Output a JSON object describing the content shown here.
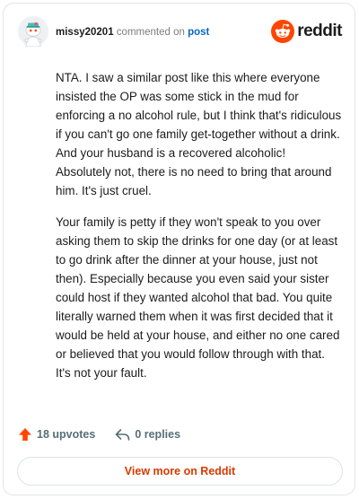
{
  "comment": {
    "author": "missy20201",
    "action_text": "commented on",
    "post_link_label": "post",
    "paragraphs": [
      "NTA. I saw a similar post like this where everyone insisted the OP was some stick in the mud for enforcing a no alcohol rule, but I think that's ridiculous if you can't go one family get-together without a drink. And your husband is a recovered alcoholic! Absolutely not, there is no need to bring that around him. It's just cruel.",
      "Your family is petty if they won't speak to you over asking them to skip the drinks for one day (or at least to go drink after the dinner at your house, just not then). Especially because you even said your sister could host if they wanted alcohol that bad. You quite literally warned them when it was first decided that it would be held at your house, and either no one cared or believed that you would follow through with that. It's not your fault."
    ],
    "upvotes_label": "18 upvotes",
    "replies_label": "0 replies"
  },
  "brand": {
    "name": "reddit",
    "color": "#ff4500",
    "link_color": "#0a66c2",
    "cta_color": "#d93a00"
  },
  "icons": {
    "avatar": "snoo-avatar-icon",
    "logo": "reddit-logo-icon",
    "upvote": "upvote-arrow-icon",
    "reply": "reply-arrow-icon"
  },
  "footer": {
    "view_more_label": "View more on Reddit"
  }
}
